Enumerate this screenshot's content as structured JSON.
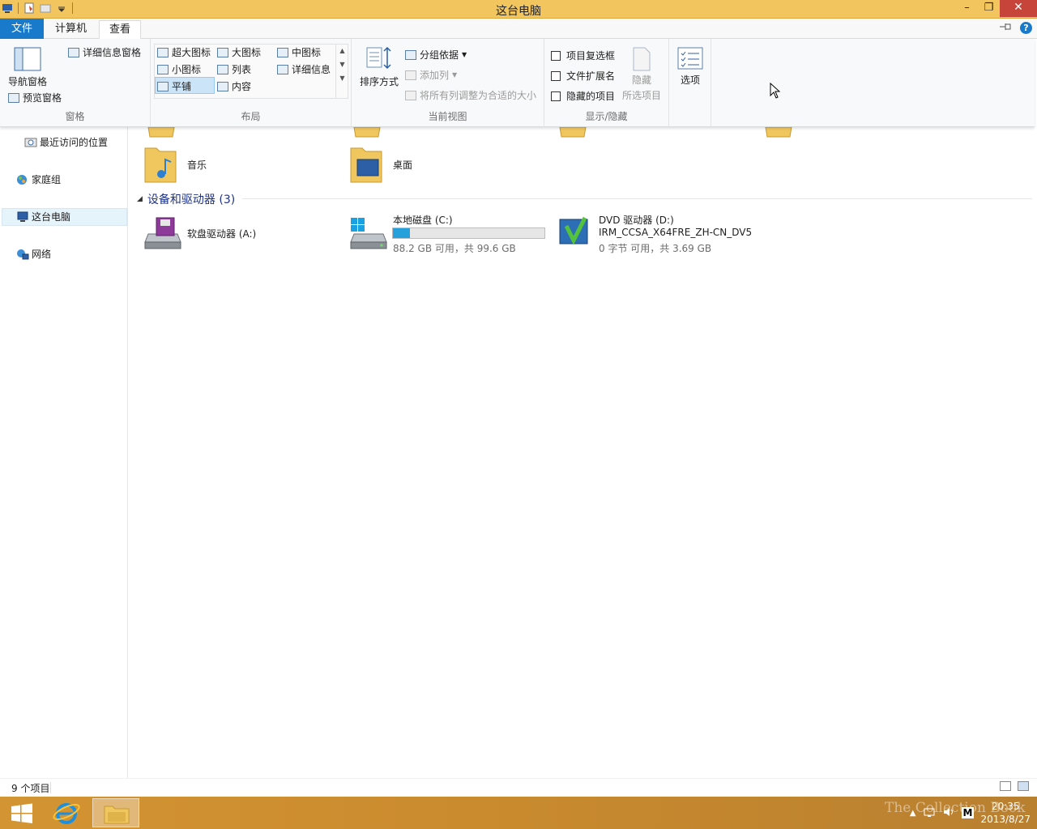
{
  "window": {
    "title": "这台电脑",
    "controls": {
      "minimize": "–",
      "restore": "❐",
      "close": "✕"
    }
  },
  "tabs": [
    {
      "label": "文件"
    },
    {
      "label": "计算机"
    },
    {
      "label": "查看"
    }
  ],
  "ribbon": {
    "panes": {
      "nav_pane": "导航窗格",
      "preview_pane": "预览窗格",
      "details_pane": "详细信息窗格",
      "label": "窗格"
    },
    "layout": {
      "extra_large": "超大图标",
      "large": "大图标",
      "medium": "中图标",
      "small": "小图标",
      "list": "列表",
      "details": "详细信息",
      "tiles": "平铺",
      "content": "内容",
      "label": "布局"
    },
    "current_view": {
      "sort_by": "排序方式",
      "group_by": "分组依据",
      "add_columns": "添加列",
      "size_columns": "将所有列调整为合适的大小",
      "label": "当前视图"
    },
    "show_hide": {
      "item_checkboxes": "项目复选框",
      "file_extensions": "文件扩展名",
      "hidden_items": "隐藏的项目",
      "hide_selected_1": "隐藏",
      "hide_selected_2": "所选项目",
      "label": "显示/隐藏"
    },
    "options": "选项"
  },
  "nav": {
    "recent": "最近访问的位置",
    "homegroup": "家庭组",
    "this_pc": "这台电脑",
    "network": "网络"
  },
  "content": {
    "folders": [
      {
        "name": "音乐"
      },
      {
        "name": "桌面"
      }
    ],
    "section_title": "设备和驱动器 (3)",
    "drives": {
      "floppy": {
        "name": "软盘驱动器 (A:)"
      },
      "local": {
        "name": "本地磁盘 (C:)",
        "free": "88.2 GB 可用，共 99.6 GB",
        "used_fraction": 0.11
      },
      "dvd": {
        "name": "DVD 驱动器 (D:)",
        "label": "IRM_CCSA_X64FRE_ZH-CN_DV5",
        "free": "0 字节 可用，共 3.69 GB"
      }
    }
  },
  "status": {
    "count": "9 个项目"
  },
  "taskbar": {
    "time": "20:35",
    "date": "2013/8/27",
    "watermark": "The Collection Book"
  },
  "colors": {
    "titlebar": "#f2c55f",
    "accent": "#1979ca",
    "drive_fill": "#26a0da"
  }
}
